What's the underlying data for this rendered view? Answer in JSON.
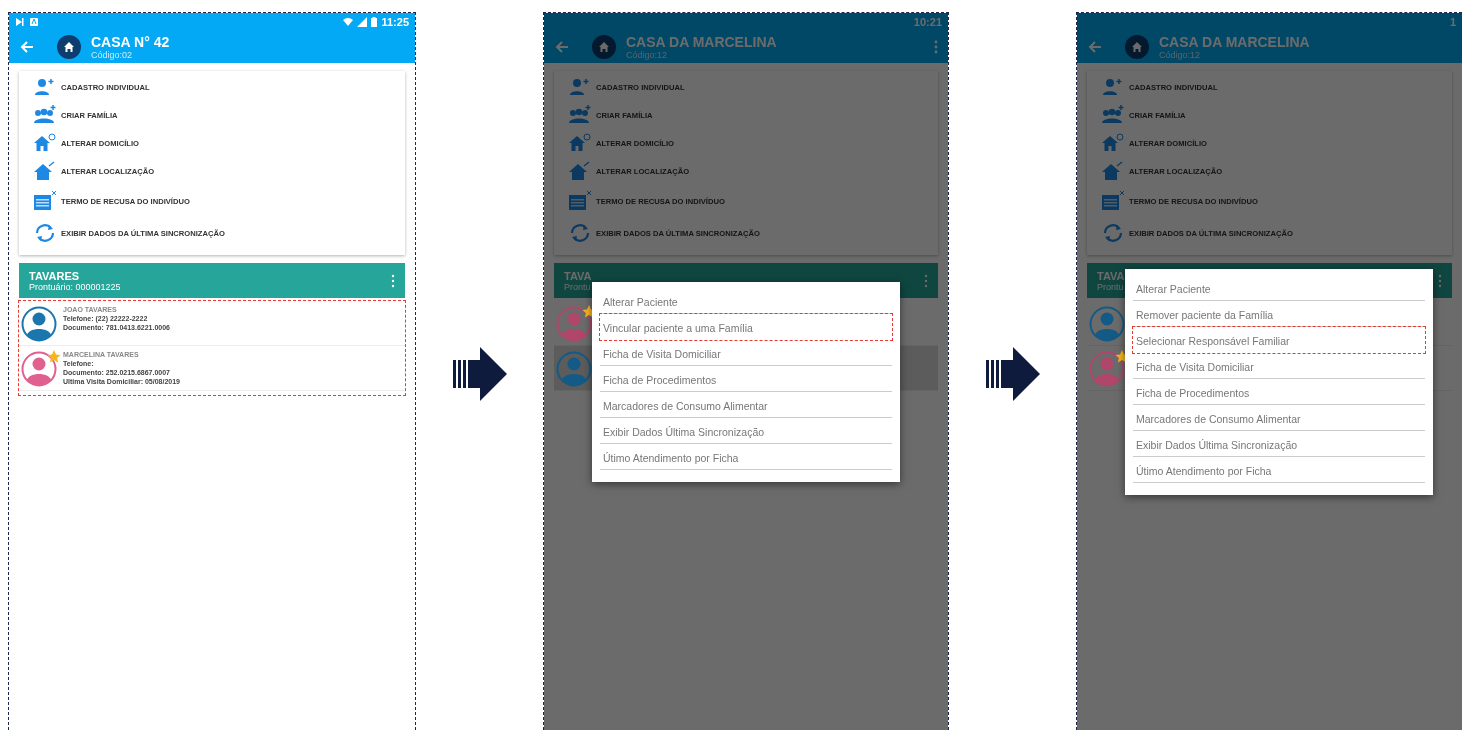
{
  "screens": [
    {
      "kind": "normal",
      "status": {
        "time": "11:25",
        "icons": true
      },
      "header": {
        "title": "CASA N° 42",
        "subtitle": "Código:02",
        "menu": false
      },
      "actions": [
        {
          "kind": "person-add",
          "label": "CADASTRO INDIVIDUAL"
        },
        {
          "kind": "group-add",
          "label": "CRIAR FAMÍLIA"
        },
        {
          "kind": "house-edit",
          "label": "ALTERAR DOMICÍLIO"
        },
        {
          "kind": "house-move",
          "label": "ALTERAR LOCALIZAÇÃO"
        },
        {
          "kind": "form-refuse",
          "label": "TERMO DE RECUSA DO INDIVÍDUO"
        },
        {
          "kind": "sync",
          "label": "EXIBIR DADOS DA ÚLTIMA SINCRONIZAÇÃO"
        }
      ],
      "family": {
        "name": "TAVARES",
        "record": "Prontuário: 000001225"
      },
      "patients_outlined": true,
      "patients": [
        {
          "color": "#1b76ad",
          "star": false,
          "selected": false,
          "lines": [
            "JOAO TAVARES",
            "Telefone: (22) 22222-2222",
            "Documento: 781.0413.6221.0006"
          ]
        },
        {
          "color": "#e0618f",
          "star": true,
          "selected": false,
          "lines": [
            "MARCELINA TAVARES",
            "Telefone:",
            "Documento: 252.0215.6867.0007",
            "Ultima Visita Domiciliar: 05/08/2019"
          ]
        }
      ]
    },
    {
      "kind": "dimmed",
      "status": {
        "time": "10:21",
        "icons": false
      },
      "header": {
        "title": "CASA DA MARCELINA",
        "subtitle": "Código:12",
        "menu": true
      },
      "actions": [
        {
          "kind": "person-add",
          "label": "CADASTRO INDIVIDUAL"
        },
        {
          "kind": "group-add",
          "label": "CRIAR FAMÍLIA"
        },
        {
          "kind": "house-edit",
          "label": "ALTERAR DOMICÍLIO"
        },
        {
          "kind": "house-move",
          "label": "ALTERAR LOCALIZAÇÃO"
        },
        {
          "kind": "form-refuse",
          "label": "TERMO DE RECUSA DO INDIVÍDUO"
        },
        {
          "kind": "sync",
          "label": "EXIBIR DADOS DA ÚLTIMA SINCRONIZAÇÃO"
        }
      ],
      "family": {
        "name": "TAVA",
        "record": "Prontu"
      },
      "patients_outlined": false,
      "patients": [
        {
          "color": "#b0466a",
          "star": true,
          "selected": false
        },
        {
          "color": "#145a86",
          "star": false,
          "selected": true
        }
      ],
      "menu": [
        {
          "label": "Alterar Paciente",
          "highlighted": false
        },
        {
          "label": "Vincular paciente a uma Família",
          "highlighted": true
        },
        {
          "label": "Ficha de Visita Domiciliar",
          "highlighted": false
        },
        {
          "label": "Ficha de Procedimentos",
          "highlighted": false
        },
        {
          "label": "Marcadores de Consumo Alimentar",
          "highlighted": false
        },
        {
          "label": "Exibir Dados Última Sincronização",
          "highlighted": false
        },
        {
          "label": "Útimo Atendimento por Ficha",
          "highlighted": false
        }
      ]
    },
    {
      "kind": "dimmed",
      "status": {
        "time": "1",
        "icons": false
      },
      "header": {
        "title": "CASA DA MARCELINA",
        "subtitle": "Código:12",
        "menu": false
      },
      "actions": [
        {
          "kind": "person-add",
          "label": "CADASTRO INDIVIDUAL"
        },
        {
          "kind": "group-add",
          "label": "CRIAR FAMÍLIA"
        },
        {
          "kind": "house-edit",
          "label": "ALTERAR DOMICÍLIO"
        },
        {
          "kind": "house-move",
          "label": "ALTERAR LOCALIZAÇÃO"
        },
        {
          "kind": "form-refuse",
          "label": "TERMO DE RECUSA DO INDIVÍDUO"
        },
        {
          "kind": "sync",
          "label": "EXIBIR DADOS DA ÚLTIMA SINCRONIZAÇÃO"
        }
      ],
      "family": {
        "name": "TAVA",
        "record": "Prontu"
      },
      "patients_outlined": false,
      "patients": [
        {
          "color": "#145a86",
          "star": false,
          "selected": false
        },
        {
          "color": "#b0466a",
          "star": true,
          "selected": false
        }
      ],
      "menu": [
        {
          "label": "Alterar Paciente",
          "highlighted": false
        },
        {
          "label": "Remover paciente da Família",
          "highlighted": false
        },
        {
          "label": "Selecionar Responsável Familiar",
          "highlighted": true
        },
        {
          "label": "Ficha de Visita Domiciliar",
          "highlighted": false
        },
        {
          "label": "Ficha de Procedimentos",
          "highlighted": false
        },
        {
          "label": "Marcadores de Consumo Alimentar",
          "highlighted": false
        },
        {
          "label": "Exibir Dados Última Sincronização",
          "highlighted": false
        },
        {
          "label": "Útimo Atendimento por Ficha",
          "highlighted": false
        }
      ]
    }
  ]
}
